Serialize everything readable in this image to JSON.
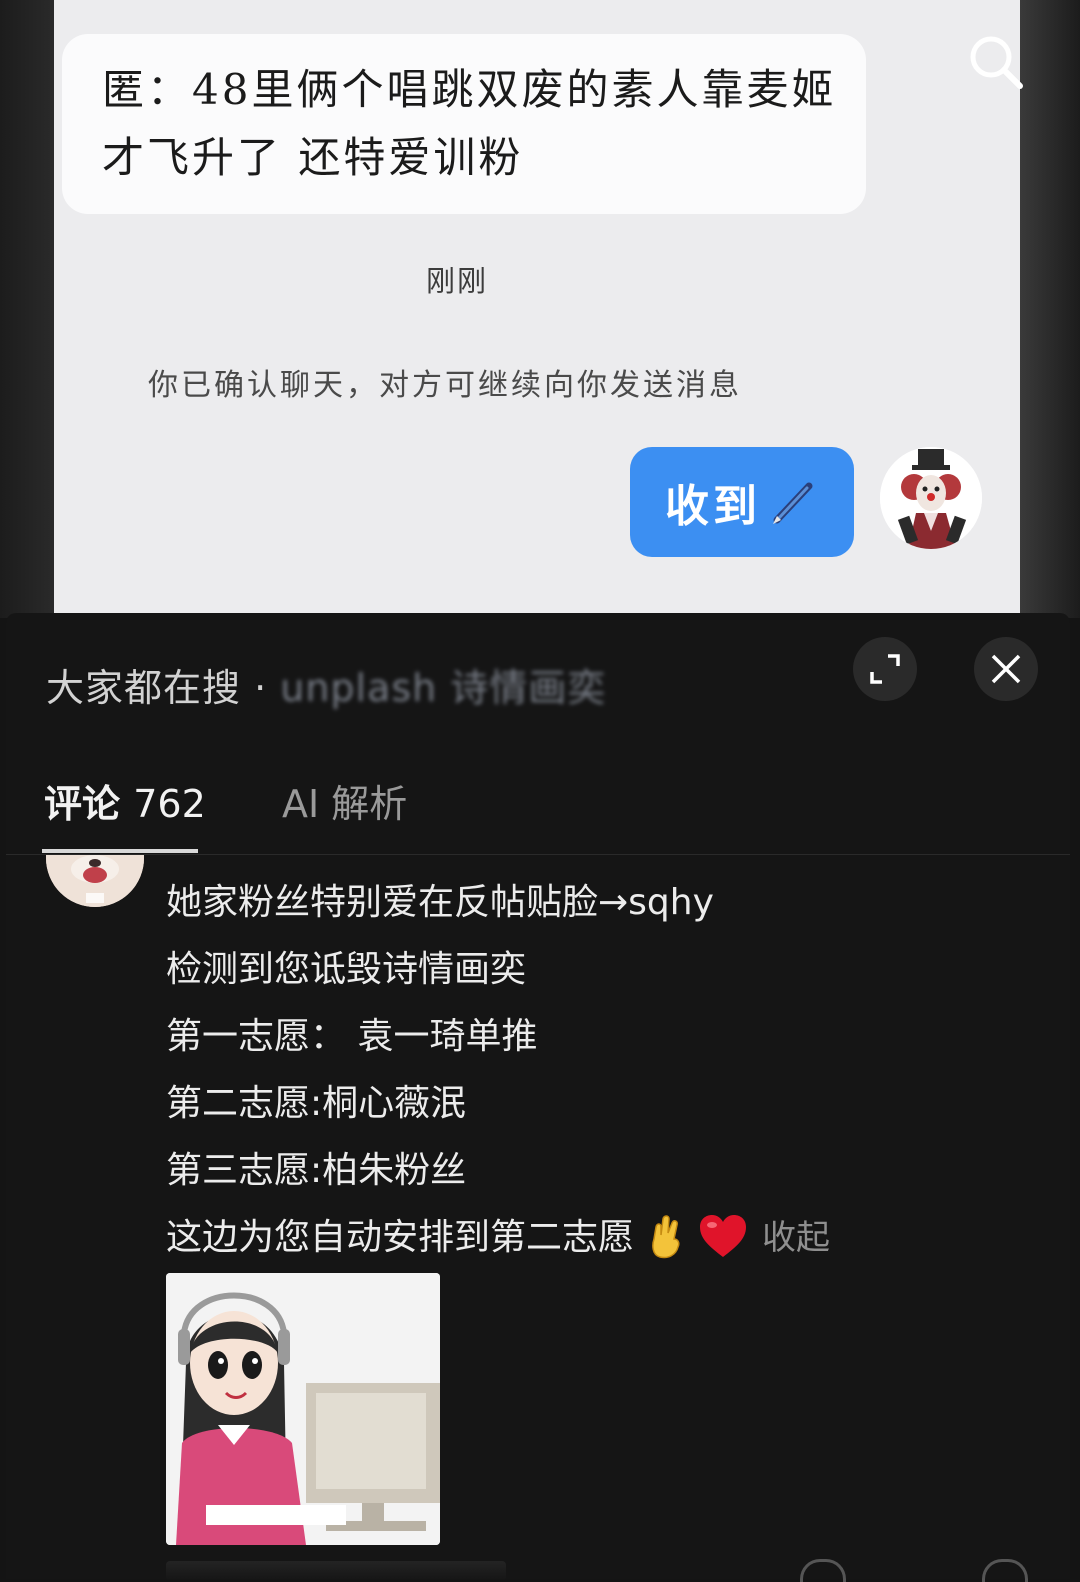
{
  "chat": {
    "message_lines": [
      "匿：48里俩个唱跳双废的素人靠麦姬",
      "才飞升了 还特爱训粉"
    ],
    "timestamp": "刚刚",
    "system_note": "你已确认聊天，对方可继续向你发送消息",
    "reply": "收到"
  },
  "sheet": {
    "search_prefix": "大家都在搜 · ",
    "search_term": "unplash 诗情画奕",
    "tabs": {
      "comments_label": "评论",
      "comments_count": "762",
      "ai_label": "AI 解析"
    },
    "comment": {
      "lines": [
        "她家粉丝特别爱在反帖贴脸→sqhy",
        "检测到您诋毁诗情画奕",
        "第一志愿： 袁一琦单推",
        "第二志愿:桐心薇泯",
        "第三志愿:柏朱粉丝"
      ],
      "last_line": "这边为您自动安排到第二志愿",
      "collapse_label": "收起"
    }
  },
  "colors": {
    "accent_blue": "#3c8ff2",
    "sheet_bg": "#151515",
    "chat_bg": "#ececee"
  },
  "icons": [
    "search-icon",
    "pen-icon",
    "expand-icon",
    "close-icon",
    "crossed-fingers-emoji",
    "heart-emoji"
  ]
}
